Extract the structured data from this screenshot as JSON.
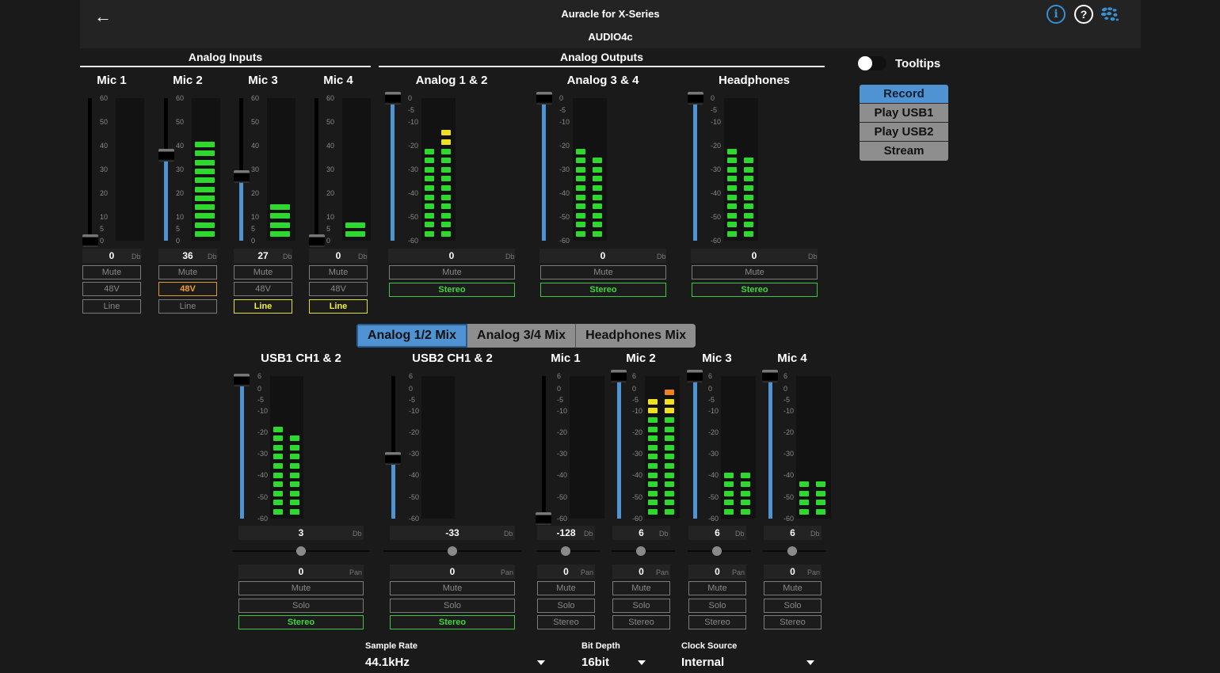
{
  "header": {
    "title": "Auracle for X-Series",
    "device": "AUDIO4c",
    "back_icon": "arrow-left",
    "info_icon": "info",
    "help_icon": "question",
    "logo_icon": "splash-logo"
  },
  "sections": {
    "inputs_title": "Analog Inputs",
    "outputs_title": "Analog Outputs"
  },
  "colors": {
    "accent": "#4f93d2",
    "meter_green": "#2ed82e",
    "meter_yellow": "#f0e020",
    "meter_orange": "#f08020",
    "button_green": "#3cd93c",
    "button_orange": "#f0a030",
    "button_yellow": "#f0f040"
  },
  "inputs": [
    {
      "label": "Mic 1",
      "gain": "0",
      "unit": "Db",
      "fader_pct": 0,
      "meter": [
        0
      ],
      "mute": "Mute",
      "phantom": "48V",
      "phantom_on": false,
      "line": "Line",
      "line_on": false
    },
    {
      "label": "Mic 2",
      "gain": "36",
      "unit": "Db",
      "fader_pct": 60,
      "meter": [
        11
      ],
      "mute": "Mute",
      "phantom": "48V",
      "phantom_on": true,
      "line": "Line",
      "line_on": false
    },
    {
      "label": "Mic 3",
      "gain": "27",
      "unit": "Db",
      "fader_pct": 45,
      "meter": [
        4
      ],
      "mute": "Mute",
      "phantom": "48V",
      "phantom_on": false,
      "line": "Line",
      "line_on": true
    },
    {
      "label": "Mic 4",
      "gain": "0",
      "unit": "Db",
      "fader_pct": 0,
      "meter": [
        2
      ],
      "mute": "Mute",
      "phantom": "48V",
      "phantom_on": false,
      "line": "Line",
      "line_on": true
    }
  ],
  "input_scale": [
    "60",
    "50",
    "40",
    "30",
    "20",
    "10",
    "5",
    "0"
  ],
  "outputs": [
    {
      "label": "Analog 1 & 2",
      "level": "0",
      "unit": "Db",
      "fader_pct": 100,
      "meter": [
        10,
        12
      ],
      "mute": "Mute",
      "stereo": "Stereo"
    },
    {
      "label": "Analog 3 & 4",
      "level": "0",
      "unit": "Db",
      "fader_pct": 100,
      "meter": [
        10,
        9
      ],
      "mute": "Mute",
      "stereo": "Stereo"
    },
    {
      "label": "Headphones",
      "level": "0",
      "unit": "Db",
      "fader_pct": 100,
      "meter": [
        10,
        9
      ],
      "mute": "Mute",
      "stereo": "Stereo"
    }
  ],
  "output_scale": [
    "0",
    "-5",
    "-10",
    "-20",
    "-30",
    "-40",
    "-50",
    "-60"
  ],
  "tooltips": {
    "label": "Tooltips",
    "enabled": false
  },
  "modes": [
    {
      "label": "Record",
      "active": true
    },
    {
      "label": "Play USB1",
      "active": false
    },
    {
      "label": "Play USB2",
      "active": false
    },
    {
      "label": "Stream",
      "active": false
    }
  ],
  "mix_tabs": [
    {
      "label": "Analog 1/2 Mix",
      "active": true
    },
    {
      "label": "Analog 3/4 Mix",
      "active": false
    },
    {
      "label": "Headphones Mix",
      "active": false
    }
  ],
  "mix_scale": [
    "6",
    "0",
    "-5",
    "-10",
    "-20",
    "-30",
    "-40",
    "-50",
    "-60"
  ],
  "mix_channels": [
    {
      "label": "USB1 CH1 & 2",
      "level": "3",
      "unit": "Db",
      "fader_pct": 97,
      "meter": [
        10,
        9
      ],
      "pan": "0",
      "pan_unit": "Pan",
      "mute": "Mute",
      "solo": "Solo",
      "stereo": "Stereo",
      "stereo_on": true,
      "wide": true
    },
    {
      "label": "USB2 CH1 & 2",
      "level": "-33",
      "unit": "Db",
      "fader_pct": 42,
      "meter": [
        0,
        0
      ],
      "pan": "0",
      "pan_unit": "Pan",
      "mute": "Mute",
      "solo": "Solo",
      "stereo": "Stereo",
      "stereo_on": true,
      "wide": true
    },
    {
      "label": "Mic 1",
      "level": "-128",
      "unit": "Db",
      "fader_pct": 0,
      "meter": [
        0,
        0
      ],
      "pan": "0",
      "pan_unit": "Pan",
      "mute": "Mute",
      "solo": "Solo",
      "stereo": "Stereo",
      "stereo_on": false,
      "wide": false
    },
    {
      "label": "Mic 2",
      "level": "6",
      "unit": "Db",
      "fader_pct": 100,
      "meter": [
        13,
        14
      ],
      "pan": "0",
      "pan_unit": "Pan",
      "mute": "Mute",
      "solo": "Solo",
      "stereo": "Stereo",
      "stereo_on": false,
      "wide": false
    },
    {
      "label": "Mic 3",
      "level": "6",
      "unit": "Db",
      "fader_pct": 100,
      "meter": [
        5,
        5
      ],
      "pan": "0",
      "pan_unit": "Pan",
      "mute": "Mute",
      "solo": "Solo",
      "stereo": "Stereo",
      "stereo_on": false,
      "wide": false
    },
    {
      "label": "Mic 4",
      "level": "6",
      "unit": "Db",
      "fader_pct": 100,
      "meter": [
        4,
        4
      ],
      "pan": "0",
      "pan_unit": "Pan",
      "mute": "Mute",
      "solo": "Solo",
      "stereo": "Stereo",
      "stereo_on": false,
      "wide": false
    }
  ],
  "settings": {
    "sample_rate_label": "Sample Rate",
    "sample_rate": "44.1kHz",
    "bit_depth_label": "Bit Depth",
    "bit_depth": "16bit",
    "clock_source_label": "Clock Source",
    "clock_source": "Internal"
  }
}
